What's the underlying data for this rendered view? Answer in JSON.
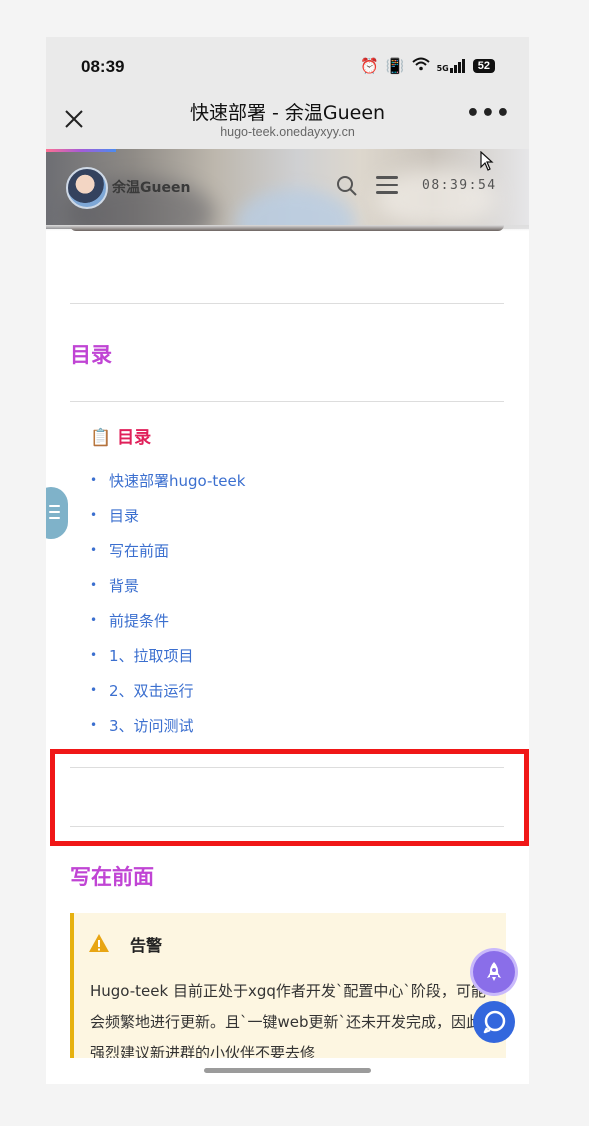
{
  "status_bar": {
    "time": "08:39",
    "network": "5G",
    "battery": "52"
  },
  "browser": {
    "title": "快速部署 - 余温Gueen",
    "url": "hugo-teek.onedayxyy.cn",
    "close_icon": "close-icon",
    "more_icon": "more-icon"
  },
  "site_header": {
    "name": "余温Gueen",
    "clock": "08:39:54"
  },
  "sections": {
    "toc_title": "目录",
    "toc_heading_icon": "📋",
    "toc_heading_label": "目录",
    "write_front_title": "写在前面"
  },
  "toc": [
    "快速部署hugo-teek",
    "目录",
    "写在前面",
    "背景",
    "前提条件",
    "1、拉取项目",
    "2、双击运行",
    "3、访问测试"
  ],
  "warning": {
    "title": "告警",
    "text": "Hugo-teek 目前正处于xgq作者开发`配置中心`阶段，可能会频繁地进行更新。且`一键web更新`还未开发完成，因此，强烈建议新进群的小伙伴不要去修"
  },
  "colors": {
    "accent_title": "#c044d4",
    "toc_heading": "#e0205a",
    "link": "#3b6fcf",
    "highlight_box": "#f01717",
    "warning_border": "#e6b10f"
  }
}
